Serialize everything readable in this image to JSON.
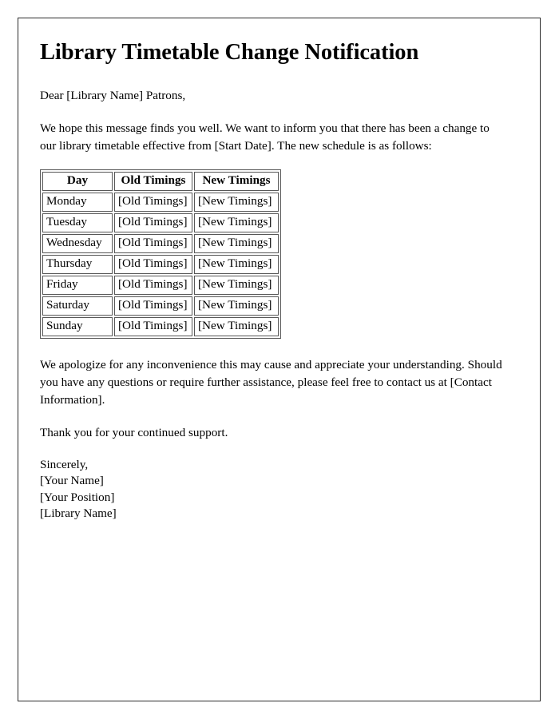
{
  "document": {
    "title": "Library Timetable Change Notification",
    "salutation": "Dear [Library Name] Patrons,",
    "intro_paragraph": "We hope this message finds you well. We want to inform you that there has been a change to our library timetable effective from [Start Date]. The new schedule is as follows:",
    "apology_paragraph": "We apologize for any inconvenience this may cause and appreciate your understanding. Should you have any questions or require further assistance, please feel free to contact us at [Contact Information].",
    "thanks_paragraph": "Thank you for your continued support.",
    "signature": {
      "closing": "Sincerely,",
      "name": "[Your Name]",
      "position": "[Your Position]",
      "organization": "[Library Name]"
    }
  },
  "timetable": {
    "headers": [
      "Day",
      "Old Timings",
      "New Timings"
    ],
    "rows": [
      {
        "day": "Monday",
        "old": "[Old Timings]",
        "new": "[New Timings]"
      },
      {
        "day": "Tuesday",
        "old": "[Old Timings]",
        "new": "[New Timings]"
      },
      {
        "day": "Wednesday",
        "old": "[Old Timings]",
        "new": "[New Timings]"
      },
      {
        "day": "Thursday",
        "old": "[Old Timings]",
        "new": "[New Timings]"
      },
      {
        "day": "Friday",
        "old": "[Old Timings]",
        "new": "[New Timings]"
      },
      {
        "day": "Saturday",
        "old": "[Old Timings]",
        "new": "[New Timings]"
      },
      {
        "day": "Sunday",
        "old": "[Old Timings]",
        "new": "[New Timings]"
      }
    ]
  },
  "colors": {
    "page_background": "#ffffff",
    "text": "#000000",
    "page_border": "#2b2b2b",
    "table_border": "#575757"
  }
}
